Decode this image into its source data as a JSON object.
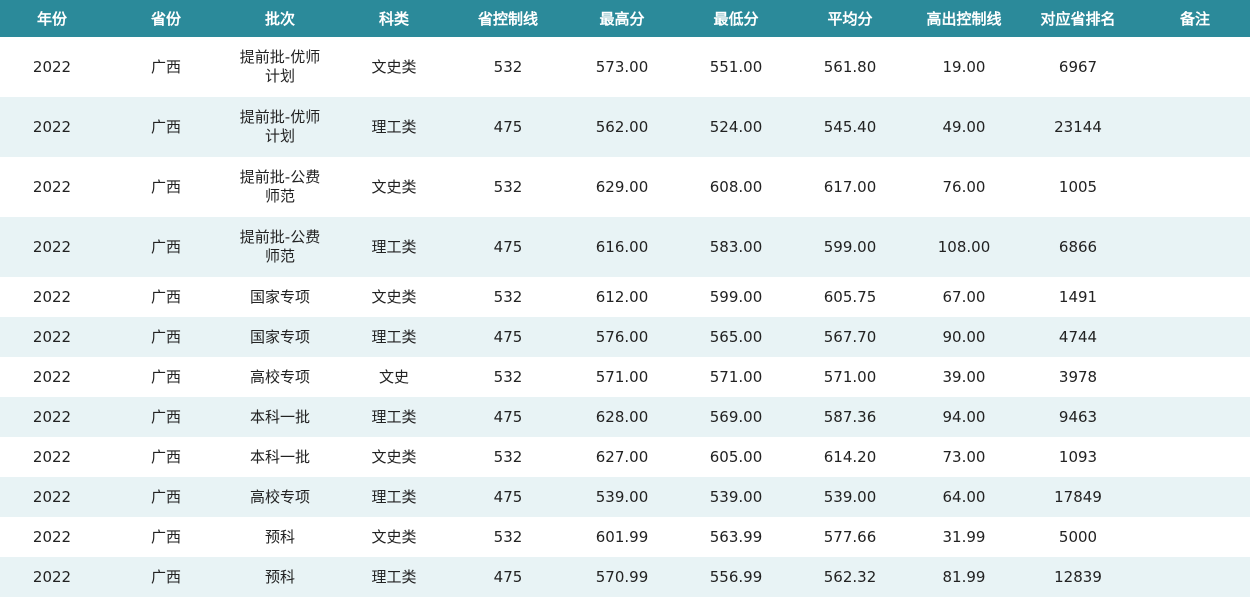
{
  "colors": {
    "header_bg": "#2b8a9a",
    "header_text": "#ffffff",
    "row_alt_bg": "#e8f3f5",
    "row_bg": "#ffffff"
  },
  "table": {
    "headers": [
      "年份",
      "省份",
      "批次",
      "科类",
      "省控制线",
      "最高分",
      "最低分",
      "平均分",
      "高出控制线",
      "对应省排名",
      "备注"
    ],
    "rows": [
      {
        "year": "2022",
        "province": "广西",
        "batch": "提前批-优师计划",
        "category": "文史类",
        "control_line": "532",
        "max": "573.00",
        "min": "551.00",
        "avg": "561.80",
        "above": "19.00",
        "rank": "6967",
        "note": ""
      },
      {
        "year": "2022",
        "province": "广西",
        "batch": "提前批-优师计划",
        "category": "理工类",
        "control_line": "475",
        "max": "562.00",
        "min": "524.00",
        "avg": "545.40",
        "above": "49.00",
        "rank": "23144",
        "note": ""
      },
      {
        "year": "2022",
        "province": "广西",
        "batch": "提前批-公费师范",
        "category": "文史类",
        "control_line": "532",
        "max": "629.00",
        "min": "608.00",
        "avg": "617.00",
        "above": "76.00",
        "rank": "1005",
        "note": ""
      },
      {
        "year": "2022",
        "province": "广西",
        "batch": "提前批-公费师范",
        "category": "理工类",
        "control_line": "475",
        "max": "616.00",
        "min": "583.00",
        "avg": "599.00",
        "above": "108.00",
        "rank": "6866",
        "note": ""
      },
      {
        "year": "2022",
        "province": "广西",
        "batch": "国家专项",
        "category": "文史类",
        "control_line": "532",
        "max": "612.00",
        "min": "599.00",
        "avg": "605.75",
        "above": "67.00",
        "rank": "1491",
        "note": ""
      },
      {
        "year": "2022",
        "province": "广西",
        "batch": "国家专项",
        "category": "理工类",
        "control_line": "475",
        "max": "576.00",
        "min": "565.00",
        "avg": "567.70",
        "above": "90.00",
        "rank": "4744",
        "note": ""
      },
      {
        "year": "2022",
        "province": "广西",
        "batch": "高校专项",
        "category": "文史",
        "control_line": "532",
        "max": "571.00",
        "min": "571.00",
        "avg": "571.00",
        "above": "39.00",
        "rank": "3978",
        "note": ""
      },
      {
        "year": "2022",
        "province": "广西",
        "batch": "本科一批",
        "category": "理工类",
        "control_line": "475",
        "max": "628.00",
        "min": "569.00",
        "avg": "587.36",
        "above": "94.00",
        "rank": "9463",
        "note": ""
      },
      {
        "year": "2022",
        "province": "广西",
        "batch": "本科一批",
        "category": "文史类",
        "control_line": "532",
        "max": "627.00",
        "min": "605.00",
        "avg": "614.20",
        "above": "73.00",
        "rank": "1093",
        "note": ""
      },
      {
        "year": "2022",
        "province": "广西",
        "batch": "高校专项",
        "category": "理工类",
        "control_line": "475",
        "max": "539.00",
        "min": "539.00",
        "avg": "539.00",
        "above": "64.00",
        "rank": "17849",
        "note": ""
      },
      {
        "year": "2022",
        "province": "广西",
        "batch": "预科",
        "category": "文史类",
        "control_line": "532",
        "max": "601.99",
        "min": "563.99",
        "avg": "577.66",
        "above": "31.99",
        "rank": "5000",
        "note": ""
      },
      {
        "year": "2022",
        "province": "广西",
        "batch": "预科",
        "category": "理工类",
        "control_line": "475",
        "max": "570.99",
        "min": "556.99",
        "avg": "562.32",
        "above": "81.99",
        "rank": "12839",
        "note": ""
      }
    ]
  }
}
